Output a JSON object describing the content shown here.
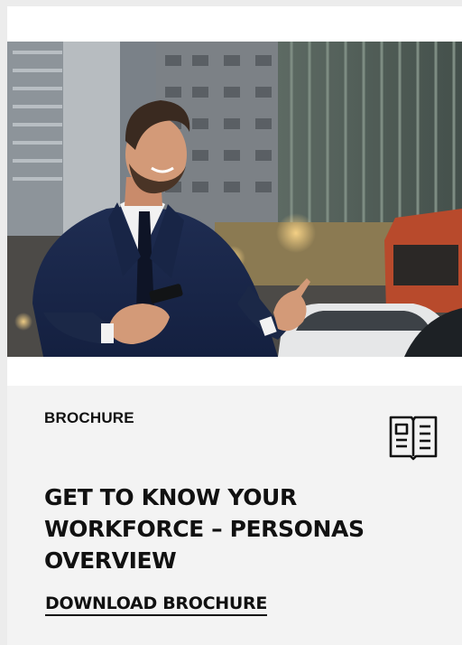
{
  "card": {
    "image": {
      "subject": "businessman-city-street-photo"
    },
    "category": "BROCHURE",
    "category_icon": "open-book-icon",
    "title": "GET TO KNOW YOUR WORKFORCE – PERSONAS OVERVIEW",
    "download_label": "DOWNLOAD BROCHURE"
  }
}
